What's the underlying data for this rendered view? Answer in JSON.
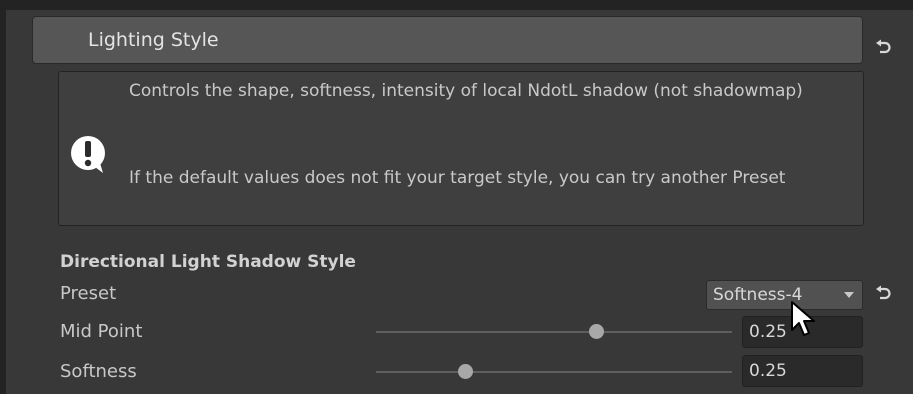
{
  "header": {
    "title": "Lighting Style"
  },
  "help": {
    "paragraph1": "Controls the shape, softness, intensity of local NdotL shadow (not shadowmap)",
    "paragraph2": "If the default values does not fit your target style, you can try another Preset"
  },
  "section": {
    "title": "Directional Light Shadow Style"
  },
  "preset": {
    "label": "Preset",
    "value": "Softness-4"
  },
  "midpoint": {
    "label": "Mid Point",
    "value": "0.25",
    "slider_fraction": 0.62
  },
  "softness": {
    "label": "Softness",
    "value": "0.25",
    "slider_fraction": 0.25
  },
  "colors": {
    "background": "#383838",
    "header": "#565656",
    "field": "#2a2a2a"
  }
}
